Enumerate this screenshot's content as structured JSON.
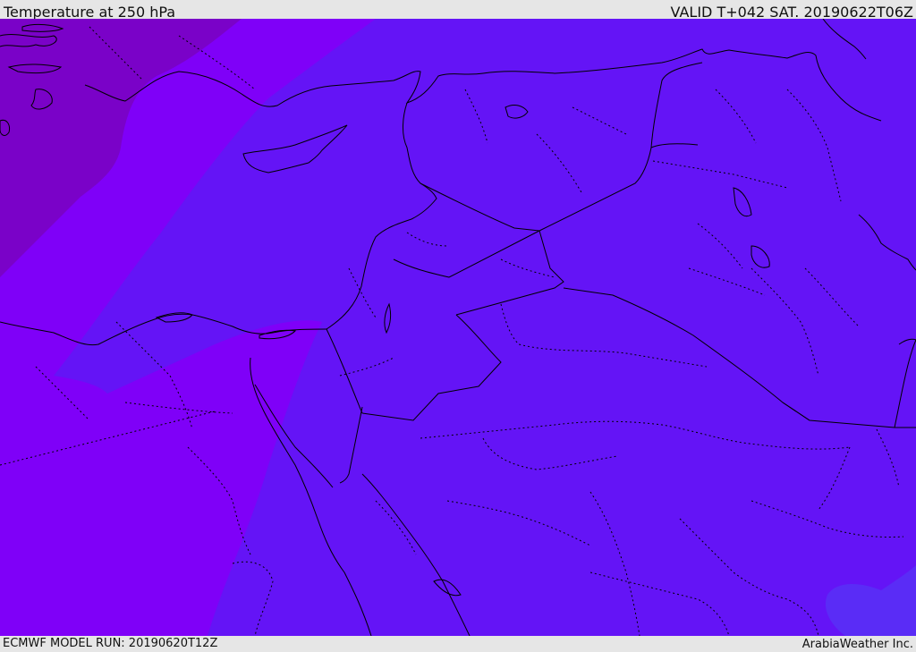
{
  "header": {
    "title": "Temperature at 250 hPa",
    "valid": "VALID T+042 SAT. 20190622T06Z"
  },
  "footer": {
    "model_run": "ECMWF MODEL RUN: 20190620T12Z",
    "credit": "ArabiaWeather Inc."
  },
  "map": {
    "colors": {
      "coldest_band": "#7a02c8",
      "cold_band": "#7f00f8",
      "main_band": "#6414f6",
      "mid_band": "#6a10f6",
      "warm_spot": "#5a2cf6",
      "coastline": "#000000",
      "borders": "#000000"
    }
  }
}
